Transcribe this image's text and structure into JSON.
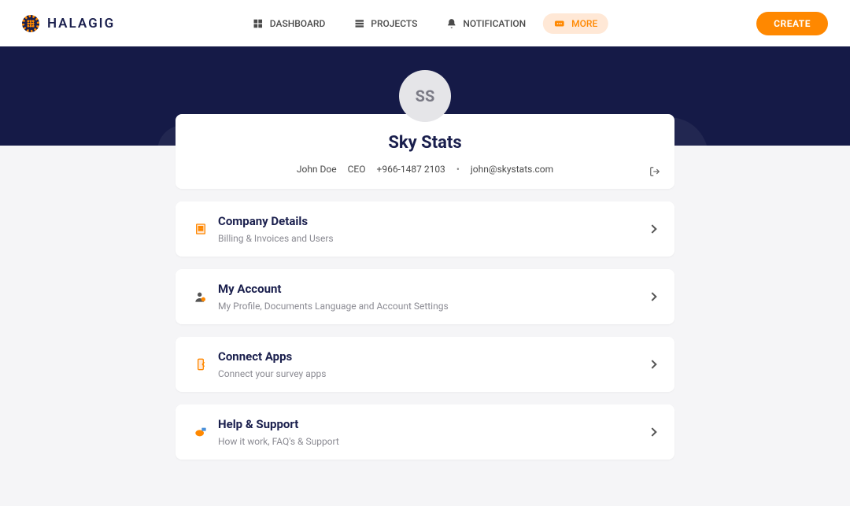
{
  "brand": "HALAGIG",
  "nav": {
    "dashboard": "DASHBOARD",
    "projects": "PROJECTS",
    "notification": "NOTIFICATION",
    "more": "MORE"
  },
  "create": "CREATE",
  "profile": {
    "initials": "SS",
    "company": "Sky Stats",
    "name": "John Doe",
    "role": "CEO",
    "phone": "+966-1487 2103",
    "email": "john@skystats.com"
  },
  "menu": {
    "company": {
      "title": "Company Details",
      "sub": "Billing & Invoices and Users"
    },
    "account": {
      "title": "My Account",
      "sub": "My Profile, Documents Language and Account Settings"
    },
    "connect": {
      "title": "Connect Apps",
      "sub": "Connect your survey apps"
    },
    "help": {
      "title": "Help & Support",
      "sub": "How it work, FAQ's & Support"
    }
  }
}
